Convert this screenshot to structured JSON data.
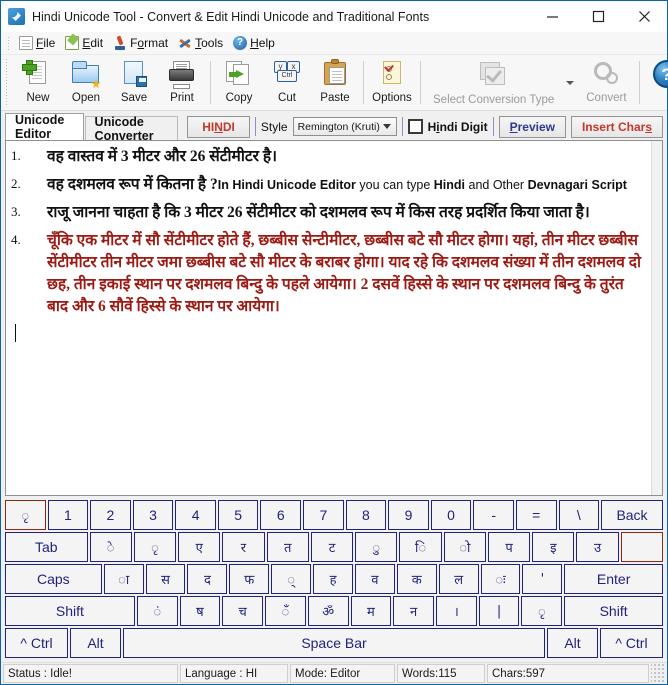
{
  "window": {
    "title": "Hindi Unicode Tool - Convert & Edit Hindi Unicode and Traditional Fonts",
    "app_icon": "link-chain-icon",
    "minimize_label": "–",
    "maximize_label": "☐",
    "close_label": "✕"
  },
  "menu": {
    "items": [
      {
        "label": "File",
        "accel": "F",
        "icon": "file-icon"
      },
      {
        "label": "Edit",
        "accel": "E",
        "icon": "edit-pencil-icon"
      },
      {
        "label": "Format",
        "accel": "o",
        "icon": "format-paint-icon"
      },
      {
        "label": "Tools",
        "accel": "T",
        "icon": "tools-hammer-icon"
      },
      {
        "label": "Help",
        "accel": "H",
        "icon": "help-circle-icon"
      }
    ]
  },
  "toolbar": {
    "buttons": [
      {
        "label": "New",
        "icon": "new-document-icon",
        "disabled": false
      },
      {
        "label": "Open",
        "icon": "open-folder-icon",
        "disabled": false
      },
      {
        "label": "Save",
        "icon": "save-disk-icon",
        "disabled": false
      },
      {
        "label": "Print",
        "icon": "printer-icon",
        "disabled": false
      },
      {
        "label": "Copy",
        "icon": "copy-icon",
        "disabled": false
      },
      {
        "label": "Cut",
        "icon": "cut-keys-icon",
        "disabled": false
      },
      {
        "label": "Paste",
        "icon": "paste-clipboard-icon",
        "disabled": false
      },
      {
        "label": "Options",
        "icon": "options-icon",
        "disabled": false
      }
    ],
    "conversion": {
      "select_label": "Select Conversion Type",
      "icon": "conversion-check-icon",
      "disabled": true
    },
    "convert": {
      "label": "Convert",
      "icon": "gear-icon",
      "disabled": true
    },
    "help": {
      "label": "?",
      "icon": "help-big-icon"
    }
  },
  "tabs": [
    {
      "label": "Unicode Editor",
      "active": true
    },
    {
      "label": "Unicode Converter",
      "active": false
    }
  ],
  "options": {
    "language_button": {
      "pre": "HI",
      "accel": "N",
      "post": "DI"
    },
    "style_label": "Style",
    "style_value": "Remington (Kruti)",
    "hindi_digit": {
      "pre": "H",
      "accel": "i",
      "post": "ndi Digit",
      "checked": false
    },
    "preview_button": {
      "pre": "",
      "accel": "P",
      "post": "review"
    },
    "insert_chars_button": {
      "pre": "Insert Char",
      "accel": "s",
      "post": ""
    }
  },
  "editor": {
    "paragraphs": [
      {
        "num": "1.",
        "style": "bold",
        "text": "वह वास्तव में 3 मीटर और 26 सेंटीमीटर है।"
      },
      {
        "num": "2.",
        "style": "bold",
        "text": "वह दशमलव रूप में कितना है ?",
        "english_runs": [
          {
            "text": "In Hindi Unicode Editor",
            "bold": true
          },
          {
            "text": " you can type ",
            "bold": false
          },
          {
            "text": "Hindi",
            "bold": true
          },
          {
            "text": " and Other ",
            "bold": false
          },
          {
            "text": "Devnagari Script",
            "bold": true
          }
        ]
      },
      {
        "num": "3.",
        "style": "bold",
        "text": "राजू जानना चाहता है कि 3 मीटर 26 सेंटीमीटर को दशमलव रूप में किस तरह प्रदर्शित किया जाता है।"
      },
      {
        "num": "4.",
        "style": "red",
        "text": "चूँकि एक मीटर में सौ सेंटीमीटर होते हैं, छब्बीस सेन्टीमीटर, छब्बीस बटे सौ मीटर होगा। यहां, तीन मीटर छब्बीस सेंटीमीटर तीन मीटर जमा छब्बीस बटे सौ मीटर के बराबर होगा। याद रहे कि दशमलव संख्या में तीन दशमलव दो छह, तीन इकाई स्थान पर दशमलव बिन्दु के पहले आयेगा। 2 दसवें हिस्से के स्थान पर दशमलव बिन्दु के तुरंत बाद और 6 सौवें हिस्से के स्थान पर आयेगा।"
      }
    ]
  },
  "keyboard": {
    "rows": [
      [
        {
          "label": "ृ",
          "cls": "dev accent"
        },
        {
          "label": "1"
        },
        {
          "label": "2"
        },
        {
          "label": "3"
        },
        {
          "label": "4"
        },
        {
          "label": "5"
        },
        {
          "label": "6"
        },
        {
          "label": "7"
        },
        {
          "label": "8"
        },
        {
          "label": "9"
        },
        {
          "label": "0"
        },
        {
          "label": "-"
        },
        {
          "label": "="
        },
        {
          "label": "\\"
        },
        {
          "label": "Back",
          "cls": "k-back"
        }
      ],
      [
        {
          "label": "Tab",
          "cls": "k-tab"
        },
        {
          "label": "े",
          "cls": "dev"
        },
        {
          "label": "ृ",
          "cls": "dev"
        },
        {
          "label": "ए",
          "cls": "dev"
        },
        {
          "label": "र",
          "cls": "dev"
        },
        {
          "label": "त",
          "cls": "dev"
        },
        {
          "label": "ट",
          "cls": "dev"
        },
        {
          "label": "ु",
          "cls": "dev"
        },
        {
          "label": "ि",
          "cls": "dev"
        },
        {
          "label": "ो",
          "cls": "dev"
        },
        {
          "label": "प",
          "cls": "dev"
        },
        {
          "label": "इ",
          "cls": "dev"
        },
        {
          "label": "उ",
          "cls": "dev"
        },
        {
          "label": "",
          "cls": "blank accent"
        }
      ],
      [
        {
          "label": "Caps",
          "cls": "k-caps"
        },
        {
          "label": "ा",
          "cls": "dev"
        },
        {
          "label": "स",
          "cls": "dev"
        },
        {
          "label": "द",
          "cls": "dev"
        },
        {
          "label": "फ",
          "cls": "dev"
        },
        {
          "label": "्",
          "cls": "dev"
        },
        {
          "label": "ह",
          "cls": "dev"
        },
        {
          "label": "व",
          "cls": "dev"
        },
        {
          "label": "क",
          "cls": "dev"
        },
        {
          "label": "ल",
          "cls": "dev"
        },
        {
          "label": "ः",
          "cls": "dev"
        },
        {
          "label": "'",
          "cls": "dev"
        },
        {
          "label": "Enter",
          "cls": "k-enter"
        }
      ],
      [
        {
          "label": "Shift",
          "cls": "k-shiftL"
        },
        {
          "label": "ं",
          "cls": "dev"
        },
        {
          "label": "ष",
          "cls": "dev"
        },
        {
          "label": "च",
          "cls": "dev"
        },
        {
          "label": "ँ",
          "cls": "dev"
        },
        {
          "label": "ॐ",
          "cls": "dev"
        },
        {
          "label": "म",
          "cls": "dev"
        },
        {
          "label": "न",
          "cls": "dev"
        },
        {
          "label": "।",
          "cls": "dev"
        },
        {
          "label": "|",
          "cls": "dev"
        },
        {
          "label": "ृ",
          "cls": "dev"
        },
        {
          "label": "Shift",
          "cls": "k-shiftR"
        }
      ],
      [
        {
          "label": "^ Ctrl",
          "cls": "k-ctrl"
        },
        {
          "label": "Alt",
          "cls": "k-alt"
        },
        {
          "label": "Space Bar",
          "cls": "k-space"
        },
        {
          "label": "Alt",
          "cls": "k-alt"
        },
        {
          "label": "^ Ctrl",
          "cls": "k-ctrl"
        }
      ]
    ]
  },
  "statusbar": {
    "status": "Status :  Idle!",
    "language": "Language : HI",
    "mode": "Mode: Editor",
    "words": "Words:115",
    "chars": "Chars:597"
  },
  "colors": {
    "title_accent": "#0a64a0",
    "key_text": "#22227a",
    "key_accent_border": "#8b2a14",
    "red_text": "#9b1b14",
    "hindi_red": "#c0392b",
    "preview_blue": "#2b3a8f"
  }
}
